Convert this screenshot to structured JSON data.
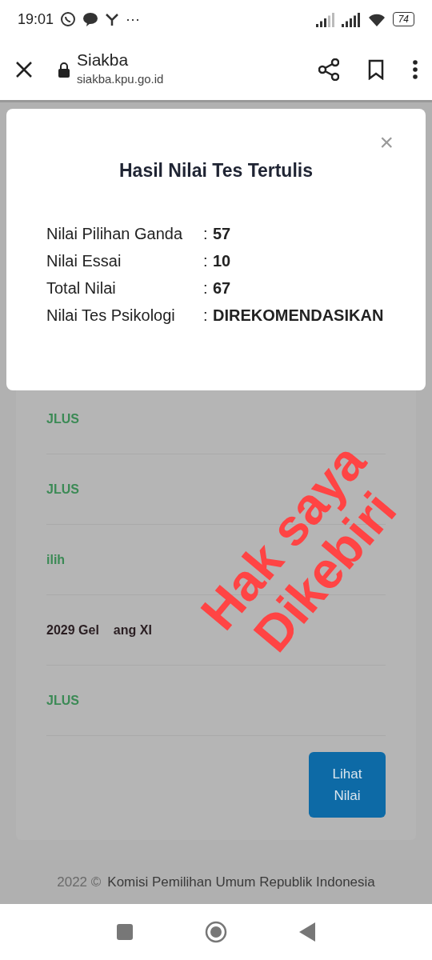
{
  "status_bar": {
    "time": "19:01",
    "more": "···",
    "battery": "74"
  },
  "browser_bar": {
    "title": "Siakba",
    "url": "siakba.kpu.go.id"
  },
  "modal": {
    "close": "×",
    "title": "Hasil Nilai Tes Tertulis",
    "rows": [
      {
        "label": "Nilai Pilihan Ganda",
        "colon": ":",
        "value": "57"
      },
      {
        "label": "Nilai Essai",
        "colon": ":",
        "value": "10"
      },
      {
        "label": "Total Nilai",
        "colon": ":",
        "value": "67"
      },
      {
        "label": "Nilai Tes Psikologi",
        "colon": ":",
        "value": "DIREKOMENDASIKAN"
      }
    ]
  },
  "background_rows": [
    {
      "kind": "status",
      "texts": [
        "JLUS"
      ]
    },
    {
      "kind": "status",
      "texts": [
        "JLUS"
      ]
    },
    {
      "kind": "status",
      "texts": [
        "ilih"
      ]
    },
    {
      "kind": "plain",
      "texts": [
        "2029 Gel",
        "ang XI"
      ]
    },
    {
      "kind": "status",
      "texts": [
        "JLUS"
      ]
    }
  ],
  "button": "Lihat Nilai",
  "footer": {
    "year": "2022 ©",
    "org": "Komisi Pemilihan Umum Republik Indonesia"
  },
  "overlay_text": [
    "Hak saya",
    "Dikebiri"
  ]
}
